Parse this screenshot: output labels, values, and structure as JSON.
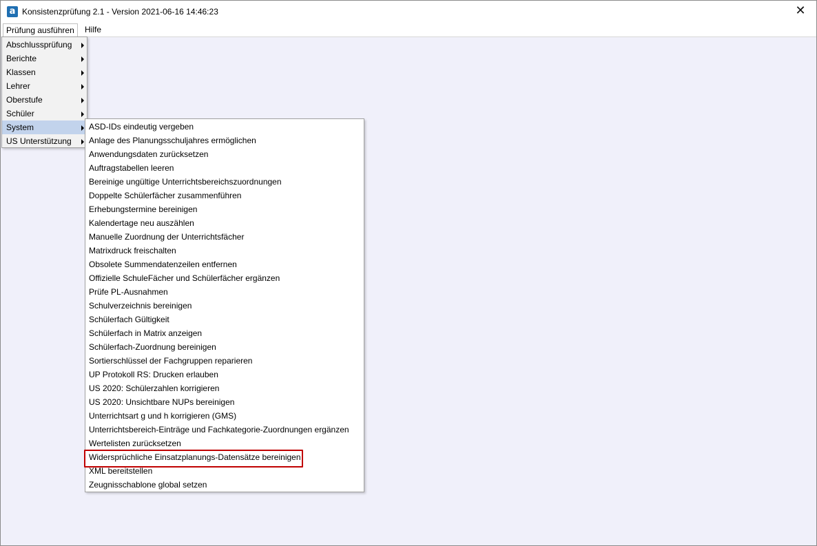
{
  "window": {
    "title": "Konsistenzprüfung 2.1 - Version 2021-06-16 14:46:23",
    "close_symbol": "✕"
  },
  "menubar": {
    "items": [
      "Prüfung ausführen",
      "Hilfe"
    ]
  },
  "main_menu": {
    "items": [
      {
        "label": "Abschlussprüfung",
        "has_submenu": true
      },
      {
        "label": "Berichte",
        "has_submenu": true
      },
      {
        "label": "Klassen",
        "has_submenu": true
      },
      {
        "label": "Lehrer",
        "has_submenu": true
      },
      {
        "label": "Oberstufe",
        "has_submenu": true
      },
      {
        "label": "Schüler",
        "has_submenu": true
      },
      {
        "label": "System",
        "has_submenu": true,
        "selected": true
      },
      {
        "label": "US Unterstützung",
        "has_submenu": true
      }
    ]
  },
  "system_submenu": {
    "items": [
      "ASD-IDs eindeutig vergeben",
      "Anlage des Planungsschuljahres ermöglichen",
      "Anwendungsdaten zurücksetzen",
      "Auftragstabellen leeren",
      "Bereinige ungültige Unterrichtsbereichszuordnungen",
      "Doppelte Schülerfächer zusammenführen",
      "Erhebungstermine bereinigen",
      "Kalendertage neu auszählen",
      "Manuelle Zuordnung der Unterrichtsfächer",
      "Matrixdruck freischalten",
      "Obsolete Summendatenzeilen entfernen",
      "Offizielle SchuleFächer und Schülerfächer ergänzen",
      "Prüfe PL-Ausnahmen",
      "Schulverzeichnis bereinigen",
      "Schülerfach Gültigkeit",
      "Schülerfach in Matrix anzeigen",
      "Schülerfach-Zuordnung bereinigen",
      "Sortierschlüssel der Fachgruppen reparieren",
      "UP Protokoll RS: Drucken erlauben",
      "US 2020: Schülerzahlen korrigieren",
      "US 2020: Unsichtbare NUPs bereinigen",
      "Unterrichtsart g und h korrigieren (GMS)",
      "Unterrichtsbereich-Einträge und Fachkategorie-Zuordnungen ergänzen",
      "Wertelisten zurücksetzen",
      "Widersprüchliche Einsatzplanungs-Datensätze bereinigen",
      "XML bereitstellen",
      "Zeugnisschablone global setzen"
    ],
    "highlighted_index": 24
  },
  "colors": {
    "highlight_border": "#c00000",
    "selected_item": "#c2d3ec",
    "client_background": "#f0f0fa"
  }
}
